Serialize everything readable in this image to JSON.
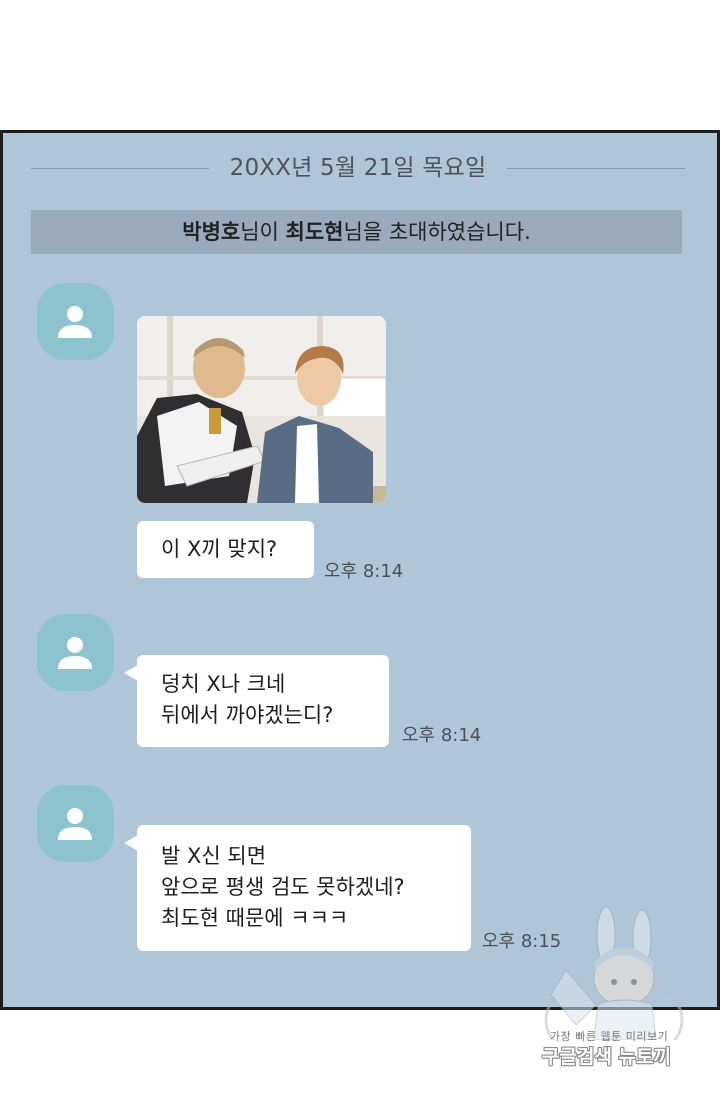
{
  "chat": {
    "date_divider": "20XX년 5월 21일 목요일",
    "system_message": {
      "inviter": "박병호",
      "middle": "님이 ",
      "invitee": "최도현",
      "suffix": "님을 초대하였습니다."
    },
    "messages": [
      {
        "image_icon": "person-avatar-icon",
        "image_content": "comic-panel-two-students",
        "text_lines": [
          "이 X끼 맞지?"
        ],
        "time": "오후 8:14"
      },
      {
        "text_lines": [
          "덩치 X나 크네",
          "뒤에서 까야겠는디?"
        ],
        "time": "오후 8:14"
      },
      {
        "text_lines": [
          "발 X신 되면",
          "앞으로 평생 검도 못하겠네?",
          "최도현 때문에 ㅋㅋㅋ"
        ],
        "time": "오후 8:15"
      }
    ]
  },
  "watermark": {
    "top_text": "가장 빠른 웹툰 미리보기",
    "bottom_text": "구글검색 뉴토끼"
  },
  "colors": {
    "chat_background": "#afc5d8",
    "banner_background": "#98aabb",
    "avatar": "#8cc3cf",
    "bubble": "#ffffff",
    "frame_border": "#1e1e1e"
  }
}
